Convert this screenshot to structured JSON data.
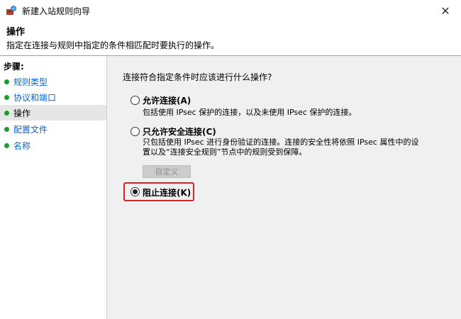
{
  "window": {
    "title": "新建入站规则向导",
    "close_glyph": "✕"
  },
  "header": {
    "title": "操作",
    "description": "指定在连接与规则中指定的条件相匹配时要执行的操作。"
  },
  "sidebar": {
    "steps_label": "步骤:",
    "items": [
      {
        "label": "规则类型"
      },
      {
        "label": "协议和端口"
      },
      {
        "label": "操作"
      },
      {
        "label": "配置文件"
      },
      {
        "label": "名称"
      }
    ],
    "active_index": 2,
    "dot_color": "#1e9b2e",
    "link_color": "#0a64c8"
  },
  "content": {
    "question": "连接符合指定条件时应该进行什么操作?",
    "options": [
      {
        "label": "允许连接(A)",
        "desc": "包括使用 IPsec 保护的连接，以及未使用 IPsec 保护的连接。",
        "checked": false
      },
      {
        "label": "只允许安全连接(C)",
        "desc": "只包括使用 IPsec 进行身份验证的连接。连接的安全性将依照 IPsec 属性中的设置以及“连接安全规则”节点中的规则受到保障。",
        "checked": false
      },
      {
        "label": "阻止连接(K)",
        "checked": true
      }
    ],
    "customize_button": "自定义",
    "highlight_color": "#e02020"
  }
}
